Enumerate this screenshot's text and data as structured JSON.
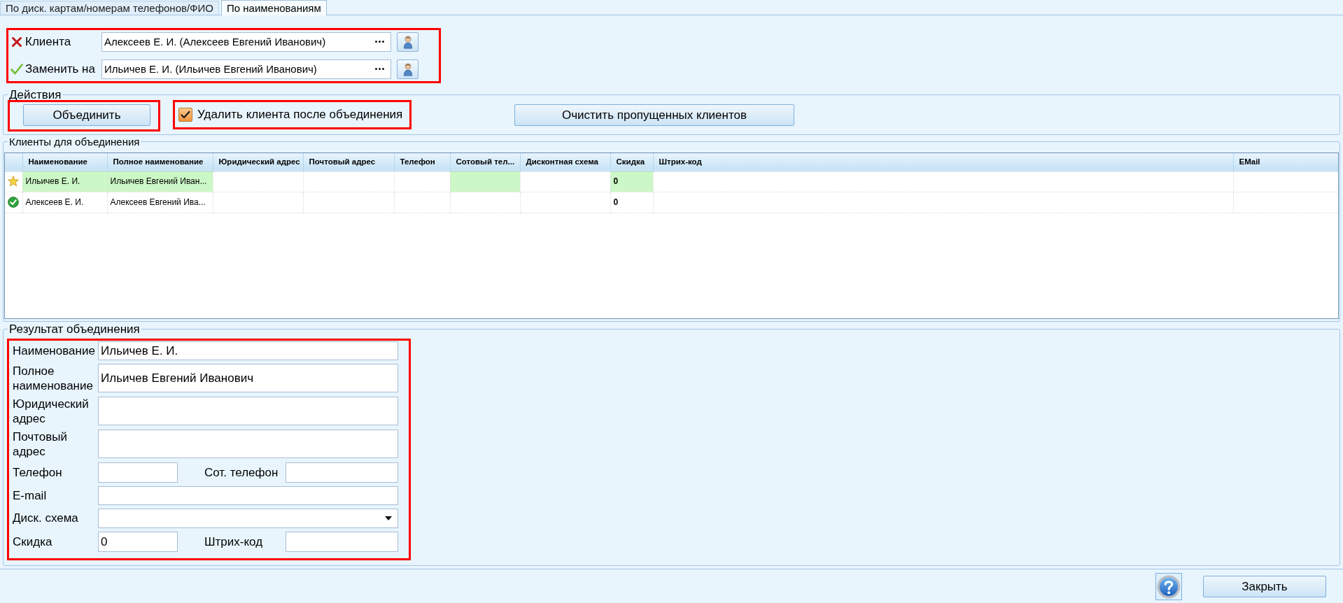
{
  "tabs": [
    {
      "label": "По диск. картам/номерам телефонов/ФИО",
      "selected": false
    },
    {
      "label": "По наименованиям",
      "selected": true
    }
  ],
  "clients": [
    {
      "kind": "cross",
      "label": "Клиента",
      "value": "Алексеев Е. И. (Алексеев Евгений Иванович)"
    },
    {
      "kind": "check",
      "label": "Заменить на",
      "value": "Ильичев Е. И. (Ильичев Евгений Иванович)"
    }
  ],
  "actions": {
    "title": "Действия",
    "merge_button": "Объединить",
    "delete_after_merge": {
      "label": "Удалить клиента после объединения",
      "checked": true
    },
    "clear_button": "Очистить пропущенных клиентов"
  },
  "merge_clients": {
    "title": "Клиенты для объединения",
    "table": {
      "columns": [
        "Наименование",
        "Полное наименование",
        "Юридический адрес",
        "Почтовый адрес",
        "Телефон",
        "Сотовый тел...",
        "Дисконтная схема",
        "Скидка",
        "Штрих-код",
        "EMail"
      ],
      "rows": [
        {
          "kind": "star",
          "cells": [
            {
              "text": "Ильичев Е. И.",
              "bold": false,
              "highlighted": true
            },
            {
              "text": "Ильичев Евгений Иван...",
              "bold": false,
              "highlighted": true
            },
            {
              "highlighted": false
            },
            {
              "highlighted": false
            },
            {
              "highlighted": false
            },
            {
              "highlighted": true
            },
            {
              "highlighted": false
            },
            {
              "text": "0",
              "bold": true,
              "highlighted": true
            },
            {
              "highlighted": false
            },
            {
              "highlighted": false
            }
          ]
        },
        {
          "kind": "check",
          "cells": [
            {
              "text": "Алексеев Е. И.",
              "bold": false,
              "highlighted": false
            },
            {
              "text": "Алексеев Евгений Ива...",
              "bold": false,
              "highlighted": false
            },
            {
              "highlighted": false
            },
            {
              "highlighted": false
            },
            {
              "highlighted": false
            },
            {
              "highlighted": false
            },
            {
              "highlighted": false
            },
            {
              "text": "0",
              "bold": true,
              "highlighted": false
            },
            {
              "highlighted": false
            },
            {
              "highlighted": false
            }
          ]
        }
      ]
    }
  },
  "result": {
    "title": "Результат объединения",
    "fields": [
      {
        "kind": "text",
        "label": "Наименование",
        "value": "Ильичев Е. И."
      },
      {
        "kind": "tall",
        "label": "Полное наименование",
        "value": "Ильичев Евгений Иванович"
      },
      {
        "kind": "tall",
        "label": "Юридический адрес"
      },
      {
        "kind": "tall",
        "label": "Почтовый адрес"
      },
      {
        "kind": "pair",
        "label": "Телефон",
        "label_2": "Сот. телефон"
      },
      {
        "kind": "text",
        "label": "E-mail"
      },
      {
        "kind": "select",
        "label": "Диск. схема"
      },
      {
        "kind": "pair",
        "label": "Скидка",
        "value": "0",
        "label_2": "Штрих-код"
      }
    ]
  },
  "footer": {
    "close_button": "Закрыть"
  }
}
